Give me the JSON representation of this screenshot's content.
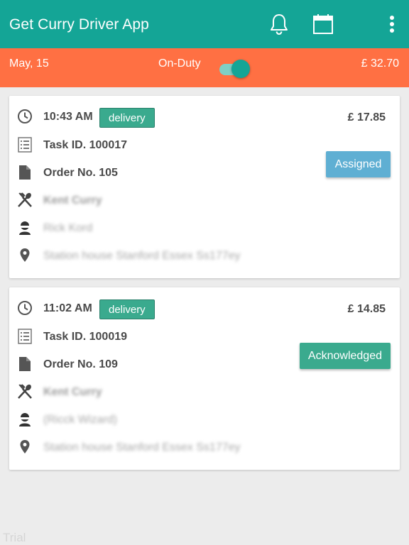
{
  "appbar": {
    "title": "Get Curry Driver App",
    "bg_color": "#14a596",
    "icons": [
      "bell-icon",
      "calendar-icon",
      "more-vert-icon"
    ]
  },
  "status_bar": {
    "date": "May, 15",
    "duty_label": "On-Duty",
    "on_duty": true,
    "total": "£ 32.70",
    "bg_color": "#ff7043"
  },
  "tasks": [
    {
      "time": "10:43 AM",
      "type": "delivery",
      "price": "£ 17.85",
      "task_id": "Task ID. 100017",
      "order_no": "Order No. 105",
      "restaurant": "Kent Curry",
      "customer": "Rick Kord",
      "address": "Station house Stanford Essex Ss177ey",
      "status": "Assigned",
      "status_color": "#5fafd3"
    },
    {
      "time": "11:02 AM",
      "type": "delivery",
      "price": "£ 14.85",
      "task_id": "Task ID. 100019",
      "order_no": "Order No. 109",
      "restaurant": "Kent Curry",
      "customer": "(Ricck Wizard)",
      "address": "Station house Stanford Essex Ss177ey",
      "status": "Acknowledged",
      "status_color": "#3aaa8e"
    }
  ],
  "watermark": "Trial"
}
